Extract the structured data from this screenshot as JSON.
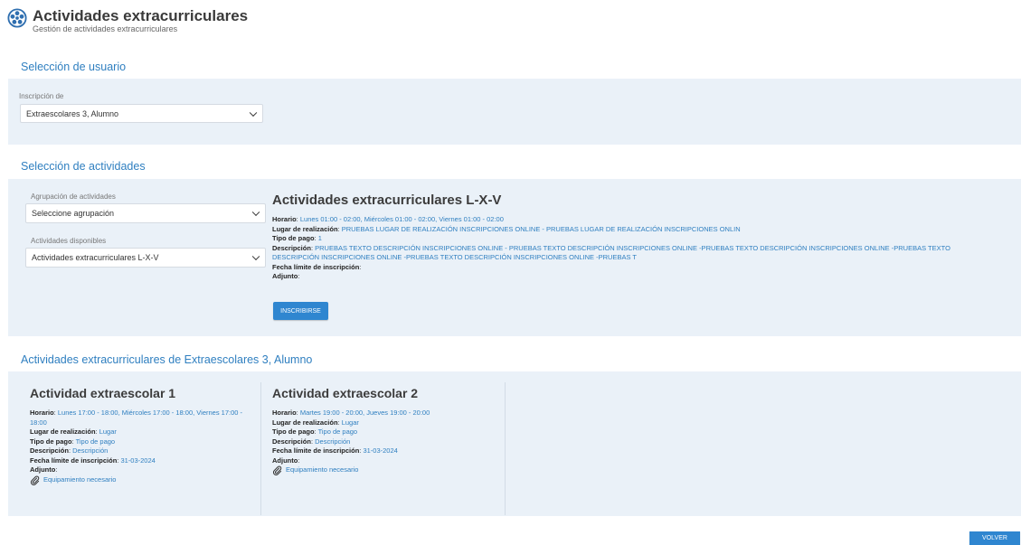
{
  "header": {
    "title": "Actividades extracurriculares",
    "subtitle": "Gestión de actividades extracurriculares",
    "logo_icon": "activity-wheel-icon"
  },
  "user_section": {
    "title": "Selección de usuario",
    "label": "Inscripción de",
    "value": "Extraescolares 3, Alumno"
  },
  "activity_section": {
    "title": "Selección de actividades",
    "group_label": "Agrupación de actividades",
    "group_value": "Seleccione agrupación",
    "available_label": "Actividades disponibles",
    "available_value": "Actividades extracurriculares L-X-V",
    "detail": {
      "title": "Actividades extracurriculares L-X-V",
      "schedule_label": "Horario",
      "schedule_value": " Lunes 01:00 - 02:00, Miércoles 01:00 - 02:00, Viernes 01:00 - 02:00",
      "place_label": "Lugar de realización",
      "place_value": " PRUEBAS LUGAR DE REALIZACIÓN INSCRIPCIONES ONLINE - PRUEBAS LUGAR DE REALIZACIÓN INSCRIPCIONES ONLIN",
      "payment_label": "Tipo de pago",
      "payment_value": " 1",
      "description_label": "Descripción",
      "description_value": " PRUEBAS TEXTO DESCRIPCIÓN INSCRIPCIONES ONLINE - PRUEBAS TEXTO DESCRIPCIÓN INSCRIPCIONES ONLINE -PRUEBAS TEXTO DESCRIPCIÓN INSCRIPCIONES ONLINE -PRUEBAS TEXTO DESCRIPCIÓN INSCRIPCIONES ONLINE -PRUEBAS TEXTO DESCRIPCIÓN INSCRIPCIONES ONLINE -PRUEBAS T",
      "deadline_label": "Fecha límite de inscripción",
      "attachment_label": "Adjunto"
    },
    "enroll_button": "INSCRIBIRSE"
  },
  "enrolled_section": {
    "title": "Actividades extracurriculares de Extraescolares 3, Alumno",
    "cards": [
      {
        "title": "Actividad extraescolar 1",
        "schedule_label": "Horario",
        "schedule_value": " Lunes 17:00 - 18:00, Miércoles 17:00 - 18:00, Viernes 17:00 - 18:00",
        "place_label": "Lugar de realización",
        "place_value": " Lugar",
        "payment_label": "Tipo de pago",
        "payment_value": " Tipo de pago",
        "description_label": "Descripción",
        "description_value": " Descripción",
        "deadline_label": "Fecha límite de inscripción",
        "deadline_value": " 31-03-2024",
        "attachment_label": "Adjunto",
        "attachment_file": "Equipamiento necesario"
      },
      {
        "title": "Actividad extraescolar 2",
        "schedule_label": "Horario",
        "schedule_value": " Martes 19:00 - 20:00, Jueves 19:00 - 20:00",
        "place_label": "Lugar de realización",
        "place_value": " Lugar",
        "payment_label": "Tipo de pago",
        "payment_value": " Tipo de pago",
        "description_label": "Descripción",
        "description_value": " Descripción",
        "deadline_label": "Fecha límite de inscripción",
        "deadline_value": " 31-03-2024",
        "attachment_label": "Adjunto",
        "attachment_file": "Equipamiento necesario"
      }
    ]
  },
  "back_button": "VOLVER",
  "colors": {
    "accent": "#2f7fc0",
    "button": "#2f86d0",
    "panel_bg": "#eaf1f8"
  }
}
